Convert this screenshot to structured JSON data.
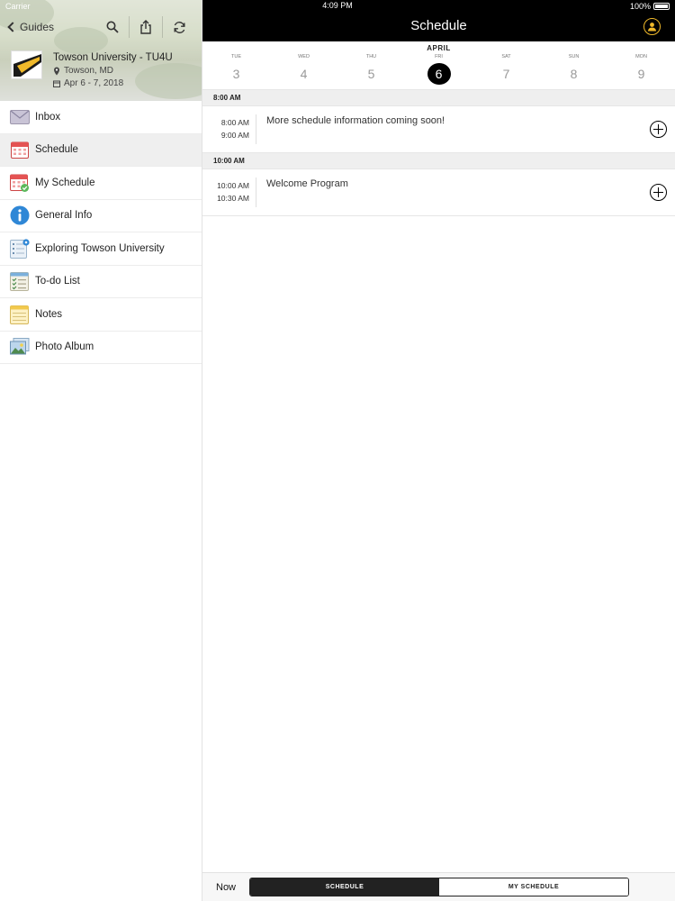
{
  "status_bar": {
    "carrier": "Carrier",
    "time": "4:09 PM",
    "battery": "100%"
  },
  "sidebar": {
    "back_label": "Guides",
    "event": {
      "title": "Towson University - TU4U",
      "location": "Towson, MD",
      "dates": "Apr 6 - 7, 2018"
    },
    "items": [
      {
        "label": "Inbox",
        "icon": "inbox-icon",
        "active": false
      },
      {
        "label": "Schedule",
        "icon": "calendar-icon",
        "active": true
      },
      {
        "label": "My Schedule",
        "icon": "my-schedule-icon",
        "active": false
      },
      {
        "label": "General Info",
        "icon": "info-icon",
        "active": false
      },
      {
        "label": "Exploring Towson University",
        "icon": "list-icon",
        "active": false
      },
      {
        "label": "To-do List",
        "icon": "checklist-icon",
        "active": false
      },
      {
        "label": "Notes",
        "icon": "notes-icon",
        "active": false
      },
      {
        "label": "Photo Album",
        "icon": "photo-icon",
        "active": false
      }
    ]
  },
  "header": {
    "title": "Schedule"
  },
  "date_strip": {
    "month": "APRIL",
    "days": [
      {
        "weekday": "TUE",
        "date": "3"
      },
      {
        "weekday": "WED",
        "date": "4"
      },
      {
        "weekday": "THU",
        "date": "5"
      },
      {
        "weekday": "FRI",
        "date": "6",
        "selected": true
      },
      {
        "weekday": "SAT",
        "date": "7"
      },
      {
        "weekday": "SUN",
        "date": "8"
      },
      {
        "weekday": "MON",
        "date": "9"
      }
    ]
  },
  "sections": [
    {
      "time": "8:00 AM",
      "events": [
        {
          "start": "8:00 AM",
          "end": "9:00 AM",
          "title": "More schedule information coming soon!"
        }
      ]
    },
    {
      "time": "10:00 AM",
      "events": [
        {
          "start": "10:00 AM",
          "end": "10:30 AM",
          "title": "Welcome Program"
        }
      ]
    }
  ],
  "bottom": {
    "now_label": "Now",
    "segment_schedule": "SCHEDULE",
    "segment_my_schedule": "MY SCHEDULE"
  },
  "colors": {
    "accent": "#f0b92a",
    "header_bg": "#000000",
    "info_blue": "#2f87d6"
  }
}
